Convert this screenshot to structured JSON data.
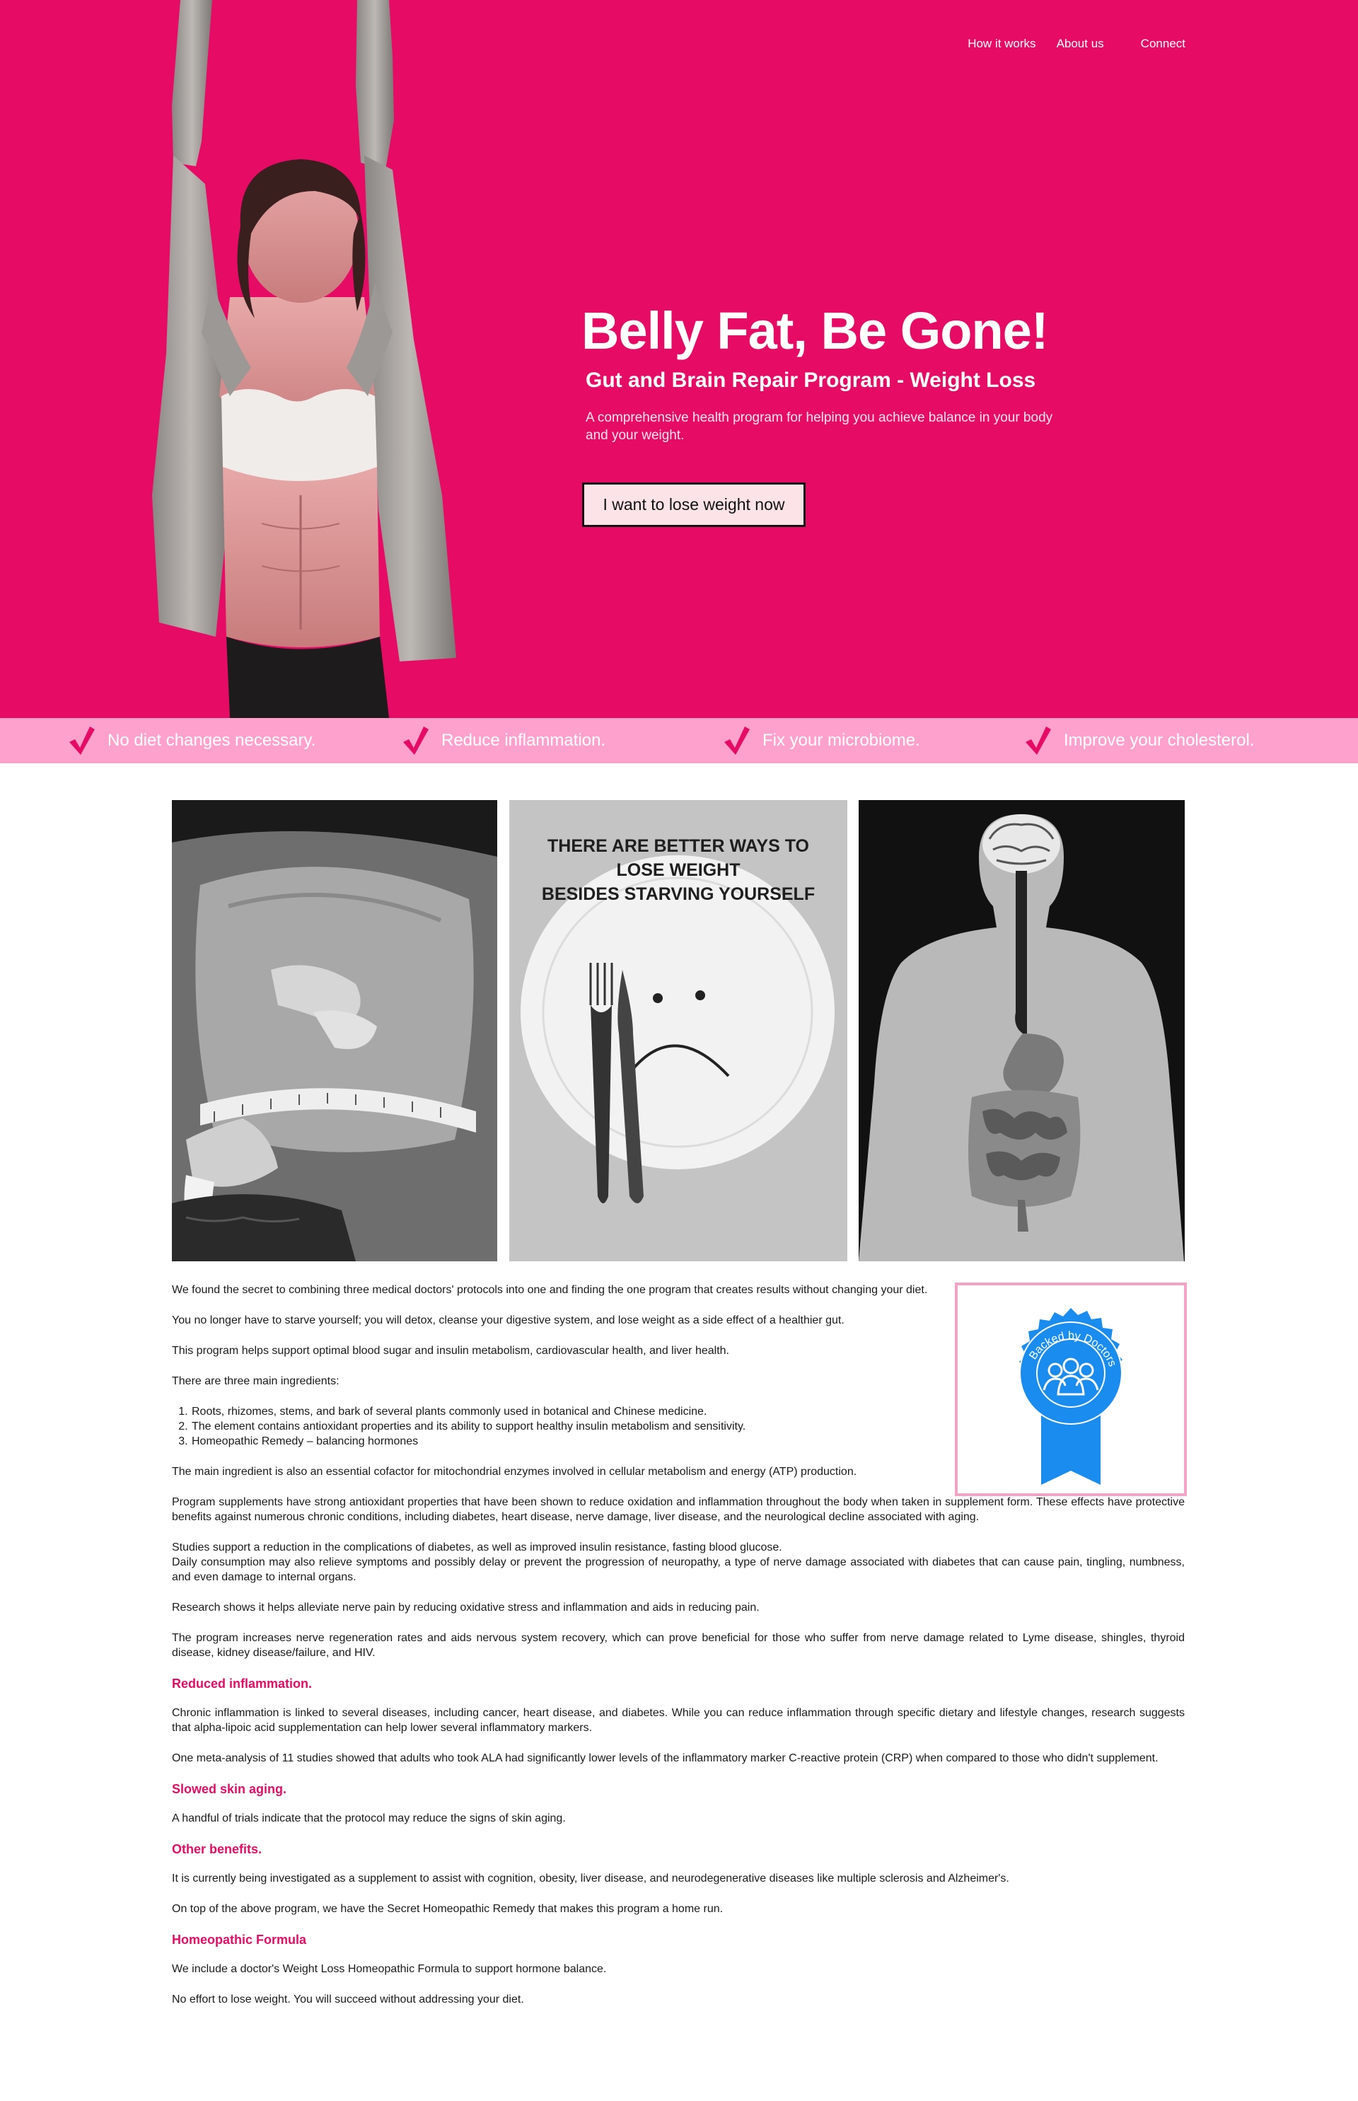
{
  "nav": {
    "items": [
      {
        "label": "How it works"
      },
      {
        "label": "About us"
      },
      {
        "label": "Connect"
      }
    ]
  },
  "hero": {
    "title": "Belly Fat, Be Gone!",
    "subtitle": "Gut and Brain Repair Program - Weight Loss",
    "description": "A comprehensive health program for helping you achieve balance in your body and your weight.",
    "cta_label": "I want to lose weight now"
  },
  "benefits": [
    {
      "label": "No diet changes necessary.",
      "icon": "checkmark-icon"
    },
    {
      "label": "Reduce inflammation.",
      "icon": "checkmark-icon"
    },
    {
      "label": "Fix your microbiome.",
      "icon": "checkmark-icon"
    },
    {
      "label": "Improve your cholesterol.",
      "icon": "checkmark-icon"
    }
  ],
  "images": {
    "plate_text": [
      "THERE ARE BETTER WAYS TO",
      "LOSE WEIGHT",
      "BESIDES STARVING YOURSELF"
    ]
  },
  "badge": {
    "text": "Backed by Doctors"
  },
  "content": {
    "p1": "We found the secret to combining three medical doctors' protocols into one and  finding the one program that creates results without changing your diet.",
    "p2": "You no longer have to starve yourself; you will detox, cleanse your digestive system, and lose weight as a side effect of a healthier gut.",
    "p3": "This program helps support optimal blood sugar and insulin metabolism, cardiovascular health, and liver health.",
    "p4": "There are three main ingredients:",
    "ingredients": [
      "Roots, rhizomes, stems, and bark of several plants commonly used in botanical and Chinese medicine.",
      "The element contains antioxidant properties and its ability to support healthy insulin metabolism and sensitivity.",
      "Homeopathic Remedy – balancing hormones"
    ],
    "p5": "The main ingredient is also an essential cofactor for mitochondrial enzymes involved in cellular metabolism and energy (ATP) production.",
    "p6": "Program supplements have strong antioxidant properties that have been shown to reduce oxidation and inflammation throughout the body when taken in supplement form. These effects have protective benefits against numerous chronic conditions, including diabetes, heart disease, nerve damage, liver disease, and the neurological decline associated with aging.",
    "p7a": "Studies support a reduction in the complications of diabetes, as well as improved insulin resistance, fasting blood glucose.",
    "p7b": "Daily consumption may also relieve symptoms and possibly delay or prevent the progression of neuropathy, a type of nerve damage associated with diabetes that can cause pain, tingling, numbness, and even damage to internal organs.",
    "p8": "Research shows it helps alleviate nerve pain by reducing oxidative stress and inflammation and aids in reducing pain.",
    "p9": "The program increases nerve regeneration rates and aids nervous system recovery, which can prove beneficial for those who suffer from nerve damage related to Lyme disease, shingles, thyroid disease, kidney disease/failure, and HIV.",
    "h1": "Reduced inflammation.",
    "p10": "Chronic inflammation is linked to several diseases, including cancer, heart disease, and diabetes. While you can reduce inflammation through specific dietary and lifestyle changes, research suggests that alpha-lipoic acid supplementation can help lower several inflammatory markers.",
    "p11": "One meta-analysis of 11 studies showed that adults who took ALA had significantly lower levels of the inflammatory marker C-reactive protein (CRP) when compared to those who didn't supplement.",
    "h2": "Slowed skin aging.",
    "p12": "A handful of trials indicate that the protocol may reduce the signs of skin aging.",
    "h3": "Other benefits.",
    "p13": "It is currently being investigated as a supplement to assist with cognition, obesity, liver disease, and neurodegenerative diseases like multiple sclerosis and Alzheimer's.",
    "p14": "On top of the above program, we have the Secret Homeopathic Remedy that makes this program a home run.",
    "h4": "Homeopathic Formula",
    "p15": "We include a doctor's Weight Loss Homeopathic Formula to support hormone balance.",
    "p16": "No effort to lose weight. You will succeed without addressing your diet."
  },
  "colors": {
    "brand_pink": "#e60c66",
    "strip_pink": "#ffa1cc",
    "badge_blue": "#1a8cf0",
    "badge_border": "#f4a3c7"
  }
}
